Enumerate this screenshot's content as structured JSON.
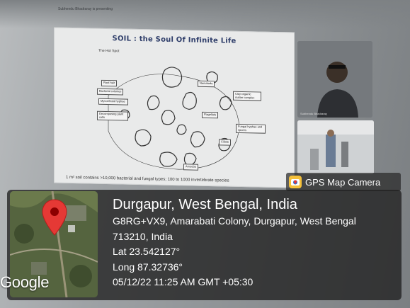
{
  "screen": {
    "presenting_text": "Subhendu Bhadraray is presenting",
    "slide": {
      "title": "SOIL : the Soul Of Infinite Life",
      "subtitle": "The Hot Spot",
      "labels": [
        "Root hair",
        "Bacterial colonies",
        "Mycorrhizal hyphae",
        "Decomposing plant cells",
        "Nematode",
        "Clay-organic matter complex",
        "Flagellate",
        "Fungal hyphae and spores",
        "Ciliate",
        "Amoeba"
      ],
      "caption": "1 m² soil contains >10,000 bacterial and fungal types; 100 to 1000 invertebrate species"
    },
    "participant_name": "Subhendu Bhadraray"
  },
  "gps_badge": {
    "label": "GPS Map Camera",
    "icon": "gps-map-camera-icon",
    "icon_color": "#f5c13b"
  },
  "location": {
    "title": "Durgapur, West Bengal, India",
    "address_line1": "G8RG+VX9, Amarabati Colony, Durgapur, West Bengal",
    "address_line2": "713210, India",
    "lat": "Lat 23.542127°",
    "long": "Long 87.32736°",
    "timestamp": "05/12/22 11:25 AM GMT +05:30"
  },
  "map": {
    "provider_logo": "Google",
    "pin_icon": "map-pin-icon",
    "pin_color": "#e53935"
  }
}
